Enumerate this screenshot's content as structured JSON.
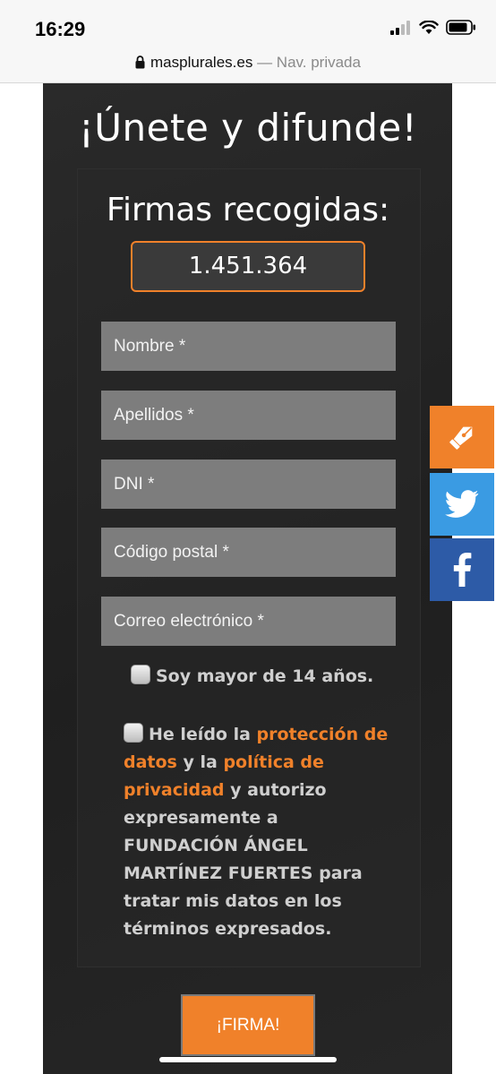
{
  "status_bar": {
    "time": "16:29"
  },
  "browser": {
    "domain": "masplurales.es",
    "separator": " — ",
    "mode": "Nav. privada"
  },
  "page": {
    "heading": "¡Únete y difunde!",
    "counter_title": "Firmas recogidas:",
    "counter_value": "1.451.364",
    "fields": [
      {
        "placeholder": "Nombre *"
      },
      {
        "placeholder": "Apellidos *"
      },
      {
        "placeholder": "DNI *"
      },
      {
        "placeholder": "Código postal *"
      },
      {
        "placeholder": "Correo electrónico *"
      }
    ],
    "age_checkbox_label": "Soy mayor de 14 años.",
    "legal": {
      "part1": "He leído la ",
      "link1": "protección de datos",
      "part2": " y la ",
      "link2": "política de privacidad",
      "part3": " y autorizo expresamente a FUNDACIÓN ÁNGEL MARTÍNEZ FUERTES para tratar mis datos en los términos expresados."
    },
    "submit_label": "¡FIRMA!"
  },
  "share_buttons": [
    {
      "icon": "pen-icon",
      "color": "#f0812a"
    },
    {
      "icon": "twitter-icon",
      "color": "#3a9be3"
    },
    {
      "icon": "facebook-icon",
      "color": "#2d5ba7"
    }
  ],
  "colors": {
    "accent": "#f0812a",
    "panel": "#222222",
    "field": "#7d7d7d"
  }
}
